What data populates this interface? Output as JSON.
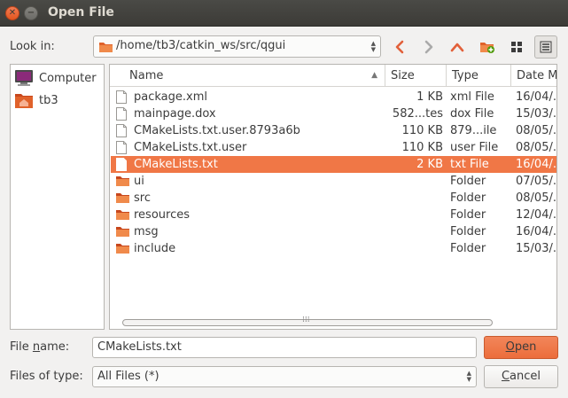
{
  "window": {
    "title": "Open File"
  },
  "look_in": {
    "label": "Look in:",
    "path": "/home/tb3/catkin_ws/src/qgui"
  },
  "toolbar": {
    "icons": [
      "back-arrow-icon",
      "forward-arrow-icon",
      "parent-directory-icon",
      "new-folder-icon",
      "icon-view-icon",
      "detail-view-icon"
    ]
  },
  "sidebar": {
    "items": [
      {
        "label": "Computer",
        "icon": "computer-icon"
      },
      {
        "label": "tb3",
        "icon": "home-folder-icon"
      }
    ]
  },
  "filelist": {
    "columns": [
      "Name",
      "Size",
      "Type",
      "Date M"
    ],
    "rows": [
      {
        "name": "package.xml",
        "size": "1 KB",
        "type": "xml File",
        "date": "16/04/...",
        "kind": "file",
        "selected": false
      },
      {
        "name": "mainpage.dox",
        "size": "582...tes",
        "type": "dox File",
        "date": "15/03/...",
        "kind": "file",
        "selected": false
      },
      {
        "name": "CMakeLists.txt.user.8793a6b",
        "size": "110 KB",
        "type": "879...ile",
        "date": "08/05/...",
        "kind": "file",
        "selected": false
      },
      {
        "name": "CMakeLists.txt.user",
        "size": "110 KB",
        "type": "user File",
        "date": "08/05/...",
        "kind": "file",
        "selected": false
      },
      {
        "name": "CMakeLists.txt",
        "size": "2 KB",
        "type": "txt File",
        "date": "16/04/...",
        "kind": "file",
        "selected": true
      },
      {
        "name": "ui",
        "size": "",
        "type": "Folder",
        "date": "07/05/...",
        "kind": "folder",
        "selected": false
      },
      {
        "name": "src",
        "size": "",
        "type": "Folder",
        "date": "08/05/...",
        "kind": "folder",
        "selected": false
      },
      {
        "name": "resources",
        "size": "",
        "type": "Folder",
        "date": "12/04/...",
        "kind": "folder",
        "selected": false
      },
      {
        "name": "msg",
        "size": "",
        "type": "Folder",
        "date": "16/04/...",
        "kind": "folder",
        "selected": false
      },
      {
        "name": "include",
        "size": "",
        "type": "Folder",
        "date": "15/03/...",
        "kind": "folder",
        "selected": false
      }
    ]
  },
  "file_name": {
    "label_pre": "File ",
    "label_mnemonic": "n",
    "label_post": "ame:",
    "value": "CMakeLists.txt"
  },
  "files_of_type": {
    "label": "Files of type:",
    "value": "All Files (*)"
  },
  "buttons": {
    "open_mnemonic": "O",
    "open_rest": "pen",
    "cancel_mnemonic": "C",
    "cancel_rest": "ancel"
  },
  "colors": {
    "accent": "#f07746",
    "titlebar": "#3c3b37"
  }
}
